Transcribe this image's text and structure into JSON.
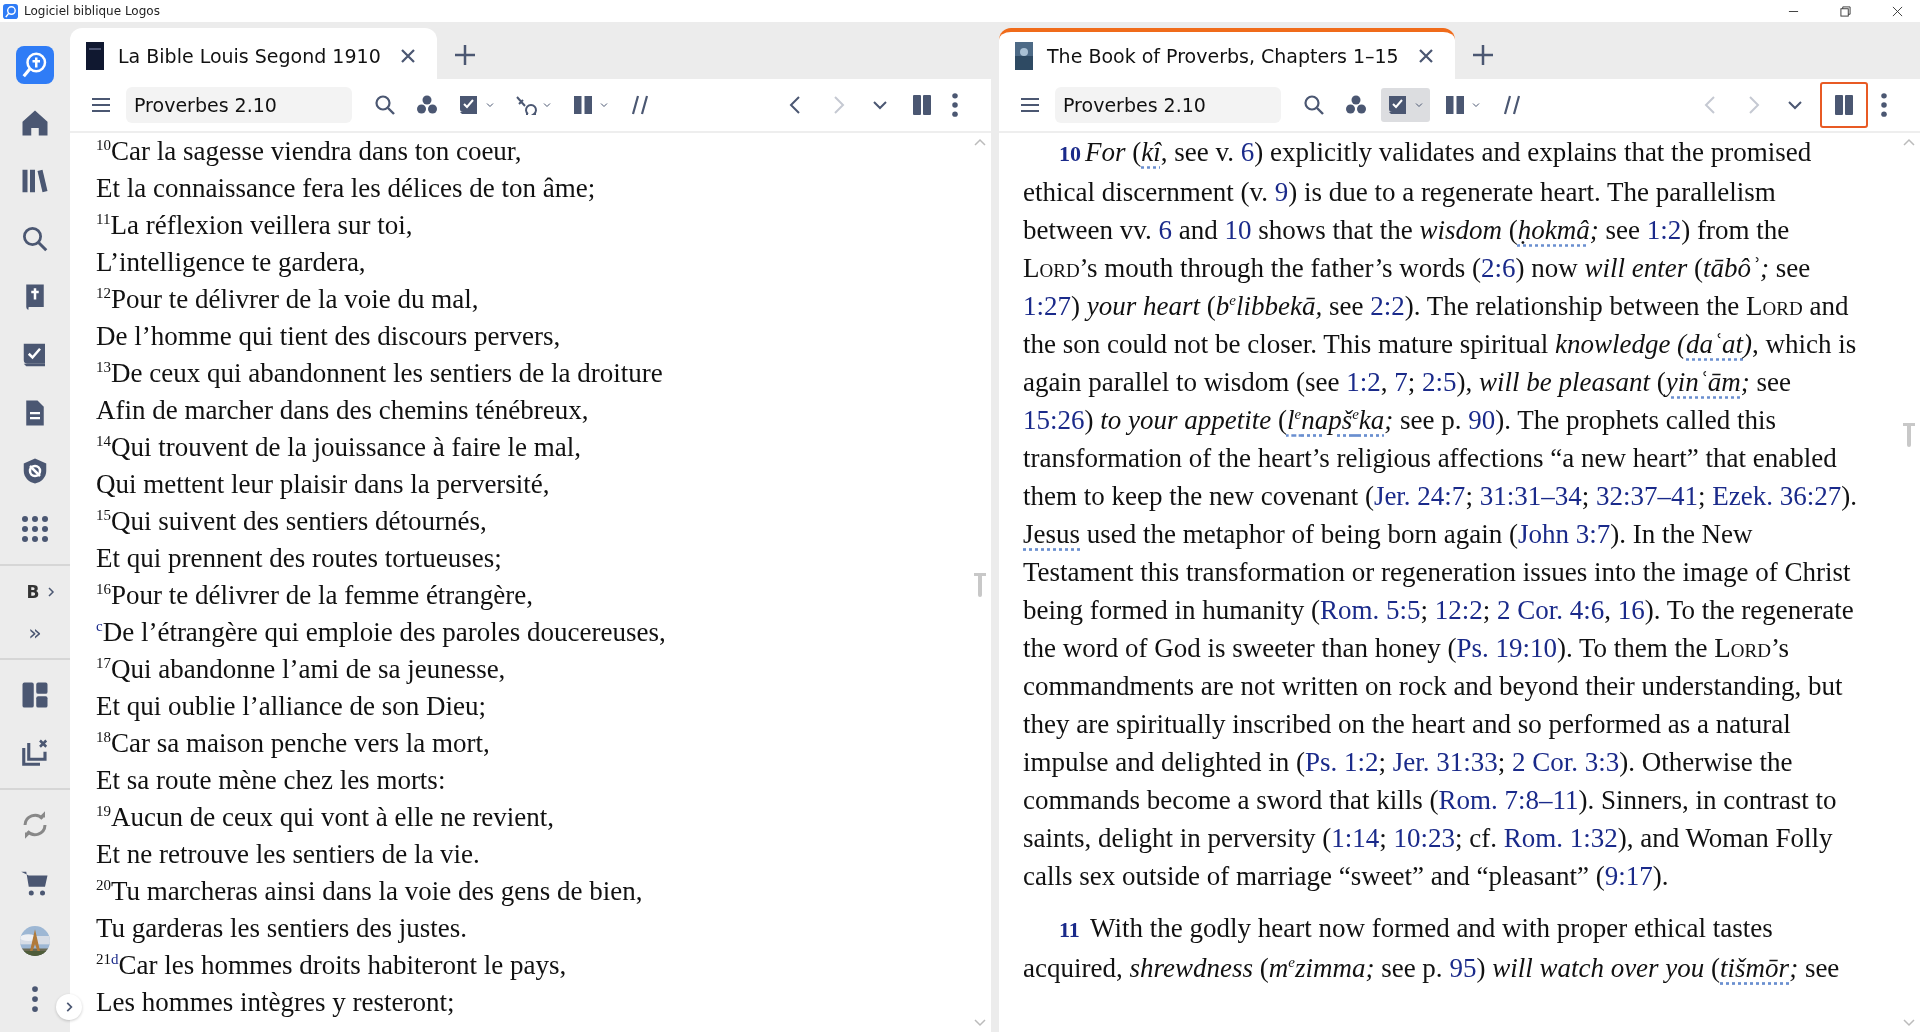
{
  "window": {
    "title": "Logiciel biblique Logos"
  },
  "sidebar": {
    "items": [
      {
        "kind": "logo"
      },
      {
        "kind": "home"
      },
      {
        "kind": "library"
      },
      {
        "kind": "search"
      },
      {
        "kind": "bible"
      },
      {
        "kind": "checklist"
      },
      {
        "kind": "document"
      },
      {
        "kind": "shield"
      },
      {
        "kind": "apps"
      },
      {
        "kind": "divider"
      },
      {
        "kind": "label",
        "label": "B"
      },
      {
        "kind": "label",
        "label": "»"
      },
      {
        "kind": "divider"
      },
      {
        "kind": "layout"
      },
      {
        "kind": "close-all"
      },
      {
        "kind": "divider"
      },
      {
        "kind": "sync"
      },
      {
        "kind": "cart"
      },
      {
        "kind": "avatar"
      },
      {
        "kind": "more"
      }
    ]
  },
  "panes": [
    {
      "tab": {
        "title": "La Bible Louis Segond 1910",
        "selected": false
      },
      "toolbar": {
        "reference": "Proverbes 2.10",
        "tools": [
          {
            "kind": "menu"
          },
          {
            "kind": "field"
          },
          {
            "kind": "search"
          },
          {
            "kind": "people"
          },
          {
            "kind": "checklist",
            "dropdown": true,
            "active": false
          },
          {
            "kind": "interlinear",
            "dropdown": true,
            "active": false
          },
          {
            "kind": "columns",
            "dropdown": true,
            "active": false
          },
          {
            "kind": "parallel"
          },
          {
            "kind": "spacer"
          },
          {
            "kind": "back",
            "disabled": false
          },
          {
            "kind": "forward",
            "disabled": true
          },
          {
            "kind": "history",
            "disabled": false
          },
          {
            "kind": "panel",
            "highlighted": false
          },
          {
            "kind": "more"
          }
        ]
      },
      "kind": "bible",
      "lines": [
        {
          "verse": "10",
          "text": "Car la sagesse viendra dans ton coeur,"
        },
        {
          "text": "Et la connaissance fera les délices de ton âme;"
        },
        {
          "verse": "11",
          "text": "La réflexion veillera sur toi,"
        },
        {
          "text": "L’intelligence te gardera,"
        },
        {
          "verse": "12",
          "text": "Pour te délivrer de la voie du mal,"
        },
        {
          "text": "De l’homme qui tient des discours pervers,"
        },
        {
          "verse": "13",
          "text": "De ceux qui abandonnent les sentiers de la droiture"
        },
        {
          "text": "Afin de marcher dans des chemins ténébreux,"
        },
        {
          "verse": "14",
          "text": "Qui trouvent de la jouissance à faire le mal,"
        },
        {
          "text": "Qui mettent leur plaisir dans la perversité,"
        },
        {
          "verse": "15",
          "text": "Qui suivent des sentiers détournés,"
        },
        {
          "text": "Et qui prennent des routes tortueuses;"
        },
        {
          "verse": "16",
          "text": "Pour te délivrer de la femme étrangère,"
        },
        {
          "note": "c",
          "text": "De l’étrangère qui emploie des paroles doucereuses,"
        },
        {
          "verse": "17",
          "text": "Qui abandonne l’ami de sa jeunesse,"
        },
        {
          "text": "Et qui oublie l’alliance de son Dieu;"
        },
        {
          "verse": "18",
          "text": "Car sa maison penche vers la mort,"
        },
        {
          "text": "Et sa route mène chez les morts:"
        },
        {
          "verse": "19",
          "text": "Aucun de ceux qui vont à elle ne revient,"
        },
        {
          "text": "Et ne retrouve les sentiers de la vie."
        },
        {
          "verse": "20",
          "text": "Tu marcheras ainsi dans la voie des gens de bien,"
        },
        {
          "text": "Tu garderas les sentiers des justes."
        },
        {
          "verse": "21",
          "note": "d",
          "text": "Car les hommes droits habiteront le pays,"
        },
        {
          "text": "Les hommes intègres y resteront;"
        }
      ]
    },
    {
      "tab": {
        "title": "The Book of Proverbs, Chapters 1–15",
        "selected": true
      },
      "toolbar": {
        "reference": "Proverbes 2.10",
        "tools": [
          {
            "kind": "menu"
          },
          {
            "kind": "field"
          },
          {
            "kind": "search"
          },
          {
            "kind": "people"
          },
          {
            "kind": "checklist",
            "dropdown": true,
            "active": true
          },
          {
            "kind": "columns",
            "dropdown": true,
            "active": false
          },
          {
            "kind": "parallel"
          },
          {
            "kind": "spacer"
          },
          {
            "kind": "back",
            "disabled": true
          },
          {
            "kind": "forward",
            "disabled": true
          },
          {
            "kind": "history",
            "disabled": false
          },
          {
            "kind": "panel",
            "highlighted": true
          },
          {
            "kind": "more"
          }
        ]
      },
      "kind": "commentary",
      "paragraphs": [
        {
          "verse": "10",
          "segments": [
            {
              "kind": "italic",
              "text": "For"
            },
            {
              "kind": "plain",
              "text": " ("
            },
            {
              "kind": "lemma",
              "text": "kî"
            },
            {
              "kind": "plain",
              "text": ", see v. "
            },
            {
              "kind": "link",
              "text": "6"
            },
            {
              "kind": "plain",
              "text": ") explicitly validates and explains that the promised ethical discernment (v. "
            },
            {
              "kind": "link",
              "text": "9"
            },
            {
              "kind": "plain",
              "text": ") is due to a regenerate heart. The parallelism between vv. "
            },
            {
              "kind": "link",
              "text": "6"
            },
            {
              "kind": "plain",
              "text": " and "
            },
            {
              "kind": "link",
              "text": "10"
            },
            {
              "kind": "plain",
              "text": " shows that the "
            },
            {
              "kind": "italic",
              "text": "wisdom"
            },
            {
              "kind": "plain",
              "text": " ("
            },
            {
              "kind": "lemma",
              "text": "ḥokmâ"
            },
            {
              "kind": "italic",
              "text": ";"
            },
            {
              "kind": "plain",
              "text": " see "
            },
            {
              "kind": "link",
              "text": "1:2"
            },
            {
              "kind": "plain",
              "text": ") from the "
            },
            {
              "kind": "smallcaps",
              "text": "Lord"
            },
            {
              "kind": "plain",
              "text": "’s mouth through the father’s words ("
            },
            {
              "kind": "link",
              "text": "2:6"
            },
            {
              "kind": "plain",
              "text": ") now "
            },
            {
              "kind": "italic",
              "text": "will enter"
            },
            {
              "kind": "plain",
              "text": " ("
            },
            {
              "kind": "italic",
              "text": "tābôʾ;"
            },
            {
              "kind": "plain",
              "text": " see "
            },
            {
              "kind": "link",
              "text": "1:27"
            },
            {
              "kind": "plain",
              "text": ") "
            },
            {
              "kind": "italic",
              "text": "your heart"
            },
            {
              "kind": "plain",
              "text": " ("
            },
            {
              "kind": "italic",
              "text": "b$^{e}$libbekā,"
            },
            {
              "kind": "plain",
              "text": " see "
            },
            {
              "kind": "link",
              "text": "2:2"
            },
            {
              "kind": "plain",
              "text": "). The relationship between the "
            },
            {
              "kind": "smallcaps",
              "text": "Lord"
            },
            {
              "kind": "plain",
              "text": " and the son could not be closer. This mature spiritual "
            },
            {
              "kind": "italic",
              "text": "knowledge ("
            },
            {
              "kind": "lemma",
              "text": "daʿat"
            },
            {
              "kind": "italic",
              "text": ")"
            },
            {
              "kind": "plain",
              "text": ", which is again parallel to wisdom (see "
            },
            {
              "kind": "link",
              "text": "1:2"
            },
            {
              "kind": "plain",
              "text": ", "
            },
            {
              "kind": "link",
              "text": "7"
            },
            {
              "kind": "plain",
              "text": "; "
            },
            {
              "kind": "link",
              "text": "2:5"
            },
            {
              "kind": "plain",
              "text": "), "
            },
            {
              "kind": "italic",
              "text": "will be pleasant"
            },
            {
              "kind": "plain",
              "text": " ("
            },
            {
              "kind": "lemma",
              "text": "yinʿām"
            },
            {
              "kind": "italic",
              "text": ";"
            },
            {
              "kind": "plain",
              "text": " see "
            },
            {
              "kind": "link",
              "text": "15:26"
            },
            {
              "kind": "plain",
              "text": ") "
            },
            {
              "kind": "italic",
              "text": "to your appetite"
            },
            {
              "kind": "plain",
              "text": " ("
            },
            {
              "kind": "lemma",
              "text": "l$^{e}$napš$^{e}$ka"
            },
            {
              "kind": "italic",
              "text": ";"
            },
            {
              "kind": "plain",
              "text": " see p. "
            },
            {
              "kind": "link",
              "text": "90"
            },
            {
              "kind": "plain",
              "text": "). The prophets called this transformation of the heart’s religious affections “a new heart” that enabled them to keep the new covenant ("
            },
            {
              "kind": "link",
              "text": "Jer. 24:7"
            },
            {
              "kind": "plain",
              "text": "; "
            },
            {
              "kind": "link",
              "text": "31:31–34"
            },
            {
              "kind": "plain",
              "text": "; "
            },
            {
              "kind": "link",
              "text": "32:37–41"
            },
            {
              "kind": "plain",
              "text": "; "
            },
            {
              "kind": "link",
              "text": "Ezek. 36:27"
            },
            {
              "kind": "plain",
              "text": "). "
            },
            {
              "kind": "term",
              "text": "Jesus"
            },
            {
              "kind": "plain",
              "text": " used the metaphor of being born again ("
            },
            {
              "kind": "link",
              "text": "John 3:7"
            },
            {
              "kind": "plain",
              "text": "). In the New Testament this transformation or regeneration issues into the image of Christ being formed in humanity ("
            },
            {
              "kind": "link",
              "text": "Rom. 5:5"
            },
            {
              "kind": "plain",
              "text": "; "
            },
            {
              "kind": "link",
              "text": "12:2"
            },
            {
              "kind": "plain",
              "text": "; "
            },
            {
              "kind": "link",
              "text": "2 Cor. 4:6"
            },
            {
              "kind": "plain",
              "text": ", "
            },
            {
              "kind": "link",
              "text": "16"
            },
            {
              "kind": "plain",
              "text": "). To the regenerate the word of God is sweeter than honey ("
            },
            {
              "kind": "link",
              "text": "Ps. 19:10"
            },
            {
              "kind": "plain",
              "text": "). To them the "
            },
            {
              "kind": "smallcaps",
              "text": "Lord"
            },
            {
              "kind": "plain",
              "text": "’s commandments are not written on rock and beyond their understanding, but they are spiritually inscribed on the heart and so performed as a natural impulse and delighted in ("
            },
            {
              "kind": "link",
              "text": "Ps. 1:2"
            },
            {
              "kind": "plain",
              "text": "; "
            },
            {
              "kind": "link",
              "text": "Jer. 31:33"
            },
            {
              "kind": "plain",
              "text": "; "
            },
            {
              "kind": "link",
              "text": "2 Cor. 3:3"
            },
            {
              "kind": "plain",
              "text": "). Otherwise the commands become a sword that kills ("
            },
            {
              "kind": "link",
              "text": "Rom. 7:8–11"
            },
            {
              "kind": "plain",
              "text": "). Sinners, in contrast to saints, delight in perversity ("
            },
            {
              "kind": "link",
              "text": "1:14"
            },
            {
              "kind": "plain",
              "text": "; "
            },
            {
              "kind": "link",
              "text": "10:23"
            },
            {
              "kind": "plain",
              "text": "; cf. "
            },
            {
              "kind": "link",
              "text": "Rom. 1:32"
            },
            {
              "kind": "plain",
              "text": "), and Woman Folly calls sex outside of marriage “sweet” and “pleasant” ("
            },
            {
              "kind": "link",
              "text": "9:17"
            },
            {
              "kind": "plain",
              "text": ")."
            }
          ]
        },
        {
          "verse": "11",
          "segments": [
            {
              "kind": "plain",
              "text": " With the godly heart now formed and with proper ethical tastes acquired, "
            },
            {
              "kind": "italic",
              "text": "shrewdness"
            },
            {
              "kind": "plain",
              "text": " ("
            },
            {
              "kind": "italic",
              "text": "m$^{e}$zimma;"
            },
            {
              "kind": "plain",
              "text": " see p. "
            },
            {
              "kind": "link",
              "text": "95"
            },
            {
              "kind": "plain",
              "text": ") "
            },
            {
              "kind": "italic",
              "text": "will watch over you"
            },
            {
              "kind": "plain",
              "text": " ("
            },
            {
              "kind": "lemma",
              "text": "tišmōr"
            },
            {
              "kind": "italic",
              "text": ";"
            },
            {
              "kind": "plain",
              "text": " see"
            }
          ]
        }
      ]
    }
  ]
}
